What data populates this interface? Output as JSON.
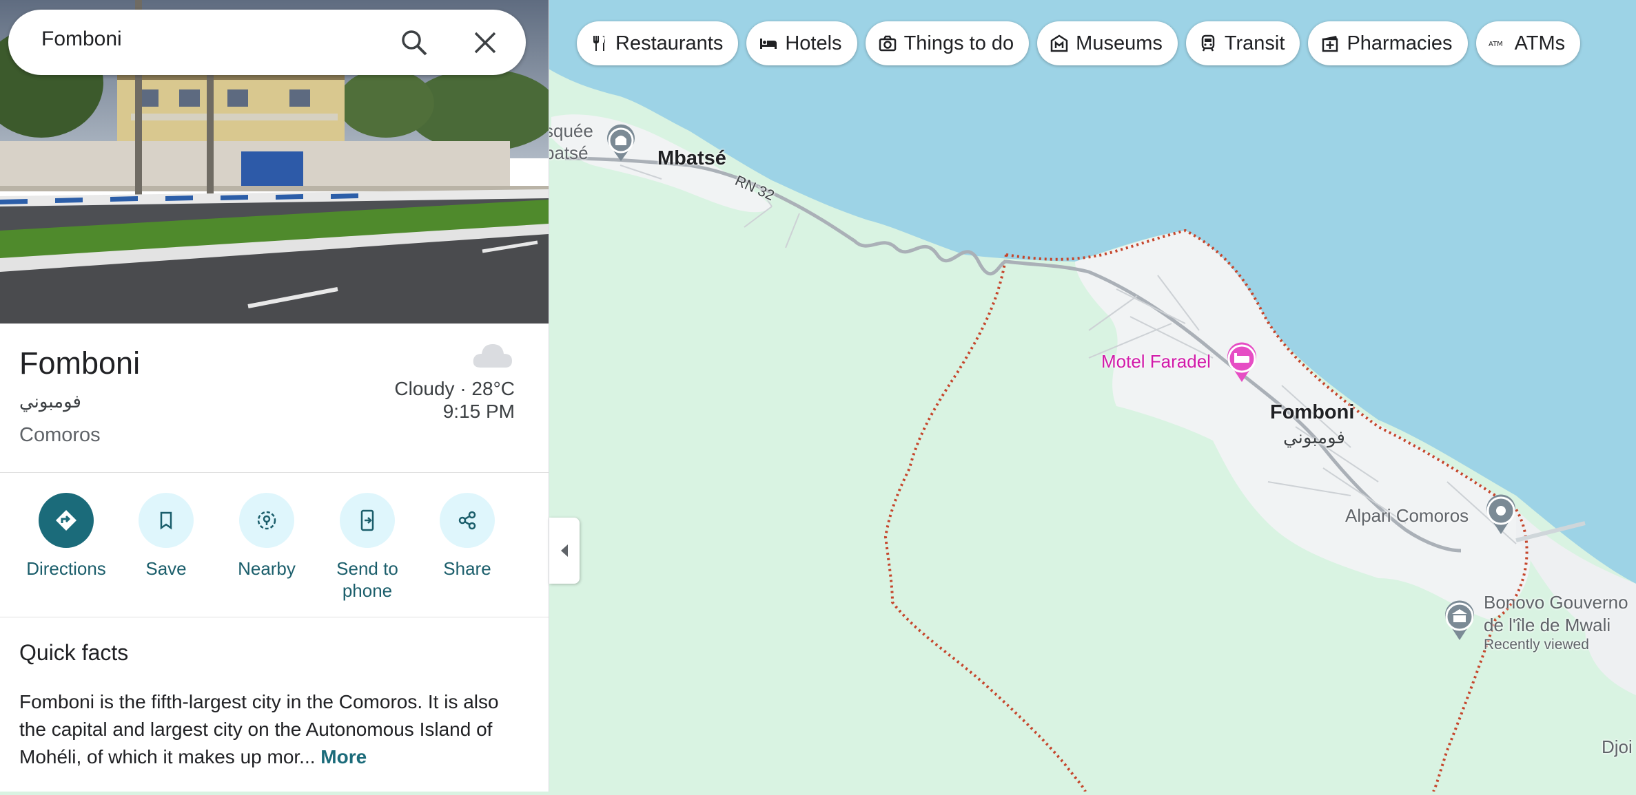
{
  "search": {
    "value": "Fomboni"
  },
  "place": {
    "name": "Fomboni",
    "local_name": "فومبوني",
    "country": "Comoros",
    "weather": "Cloudy · 28°C",
    "time": "9:15 PM"
  },
  "actions": [
    {
      "label": "Directions",
      "icon": "directions-icon"
    },
    {
      "label": "Save",
      "icon": "bookmark-icon"
    },
    {
      "label": "Nearby",
      "icon": "nearby-icon"
    },
    {
      "label": "Send to\nphone",
      "icon": "send-to-phone-icon"
    },
    {
      "label": "Share",
      "icon": "share-icon"
    }
  ],
  "quick_facts": {
    "title": "Quick facts",
    "text": "Fomboni is the fifth-largest city in the Comoros. It is also the capital and largest city on the Autonomous Island of Mohéli, of which it makes up mor...",
    "more": "More"
  },
  "chips": [
    {
      "label": "Restaurants",
      "icon": "restaurant-icon"
    },
    {
      "label": "Hotels",
      "icon": "hotel-icon"
    },
    {
      "label": "Things to do",
      "icon": "camera-icon"
    },
    {
      "label": "Museums",
      "icon": "museum-icon"
    },
    {
      "label": "Transit",
      "icon": "transit-icon"
    },
    {
      "label": "Pharmacies",
      "icon": "pharmacy-icon"
    },
    {
      "label": "ATMs",
      "icon": "atm-icon"
    }
  ],
  "map": {
    "labels": {
      "mosque_1": "squée",
      "mosque_2": "batsé",
      "mbatse": "Mbatsé",
      "road": "RN 32",
      "hotel": "Motel Faradel",
      "town": "Fomboni",
      "town_arabic": "فومبوني",
      "alpari": "Alpari Comoros",
      "gov_1": "Bonovo Gouverno",
      "gov_2": "de l'île de Mwali",
      "recently_viewed": "Recently viewed",
      "djoi": "Djoi"
    },
    "colors": {
      "water": "#9dd3e6",
      "land": "#d9f3e2",
      "urban": "#f1f3f4",
      "boundary": "#c5452b",
      "road": "#aab0b7",
      "hotel_pin": "#e64dc4"
    }
  }
}
